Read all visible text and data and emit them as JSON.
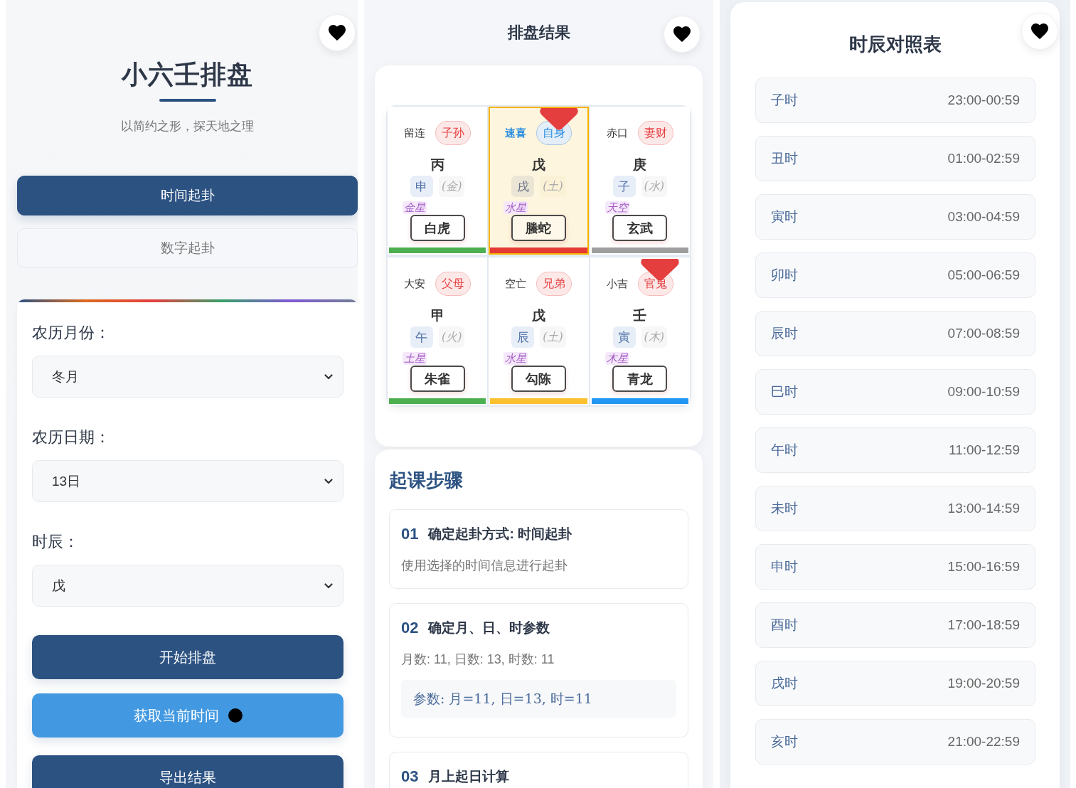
{
  "header": {
    "title": "小六壬排盘",
    "subtitle": "以简约之形，探天地之理"
  },
  "mode_tabs": [
    {
      "label": "时间起卦",
      "selected": true
    },
    {
      "label": "数字起卦",
      "selected": false
    }
  ],
  "form": {
    "fields": [
      {
        "label": "农历月份：",
        "value": "冬月"
      },
      {
        "label": "农历日期：",
        "value": "13日"
      },
      {
        "label": "时辰：",
        "value": "戊"
      }
    ],
    "buttons": [
      {
        "label": "开始排盘",
        "kind": "primary"
      },
      {
        "label": "获取当前时间",
        "kind": "accent"
      },
      {
        "label": "导出结果",
        "kind": "primary"
      }
    ]
  },
  "result": {
    "title": "排盘结果",
    "cells": [
      {
        "name": "留连",
        "relation": "子孙",
        "stem": "丙",
        "branch": "申",
        "element": "(金)",
        "star": "金星",
        "deity": "白虎",
        "color": "#4caf50",
        "highlighted": false,
        "marked": false
      },
      {
        "name": "速喜",
        "relation": "自身",
        "stem": "戊",
        "branch": "戌",
        "element": "(土)",
        "star": "水星",
        "deity": "螣蛇",
        "color": "#e53935",
        "highlighted": true,
        "marked": true
      },
      {
        "name": "赤口",
        "relation": "妻财",
        "stem": "庚",
        "branch": "子",
        "element": "(水)",
        "star": "天空",
        "deity": "玄武",
        "color": "#9e9e9e",
        "highlighted": false,
        "marked": false
      },
      {
        "name": "大安",
        "relation": "父母",
        "stem": "甲",
        "branch": "午",
        "element": "(火)",
        "star": "土星",
        "deity": "朱雀",
        "color": "#4caf50",
        "highlighted": false,
        "marked": false
      },
      {
        "name": "空亡",
        "relation": "兄弟",
        "stem": "戊",
        "branch": "辰",
        "element": "(土)",
        "star": "水星",
        "deity": "勾陈",
        "color": "#fbc02d",
        "highlighted": false,
        "marked": false
      },
      {
        "name": "小吉",
        "relation": "官鬼",
        "stem": "壬",
        "branch": "寅",
        "element": "(木)",
        "star": "木星",
        "deity": "青龙",
        "color": "#2196f3",
        "highlighted": false,
        "marked": true
      }
    ]
  },
  "steps": {
    "title": "起课步骤",
    "items": [
      {
        "number": "01",
        "title": "确定起卦方式: 时间起卦",
        "description": "使用选择的时间信息进行起卦"
      },
      {
        "number": "02",
        "title": "确定月、日、时参数",
        "description": "月数: 11, 日数: 13, 时数: 11",
        "formula": "参数: 月=11, 日=13, 时=11"
      },
      {
        "number": "03",
        "title": "月上起日计算"
      }
    ]
  },
  "hour_table": {
    "title": "时辰对照表",
    "rows": [
      {
        "name": "子时",
        "time": "23:00-00:59"
      },
      {
        "name": "丑时",
        "time": "01:00-02:59"
      },
      {
        "name": "寅时",
        "time": "03:00-04:59"
      },
      {
        "name": "卯时",
        "time": "05:00-06:59"
      },
      {
        "name": "辰时",
        "time": "07:00-08:59"
      },
      {
        "name": "巳时",
        "time": "09:00-10:59"
      },
      {
        "name": "午时",
        "time": "11:00-12:59"
      },
      {
        "name": "未时",
        "time": "13:00-14:59"
      },
      {
        "name": "申时",
        "time": "15:00-16:59"
      },
      {
        "name": "酉时",
        "time": "17:00-18:59"
      },
      {
        "name": "戌时",
        "time": "19:00-20:59"
      },
      {
        "name": "亥时",
        "time": "21:00-22:59"
      }
    ]
  }
}
